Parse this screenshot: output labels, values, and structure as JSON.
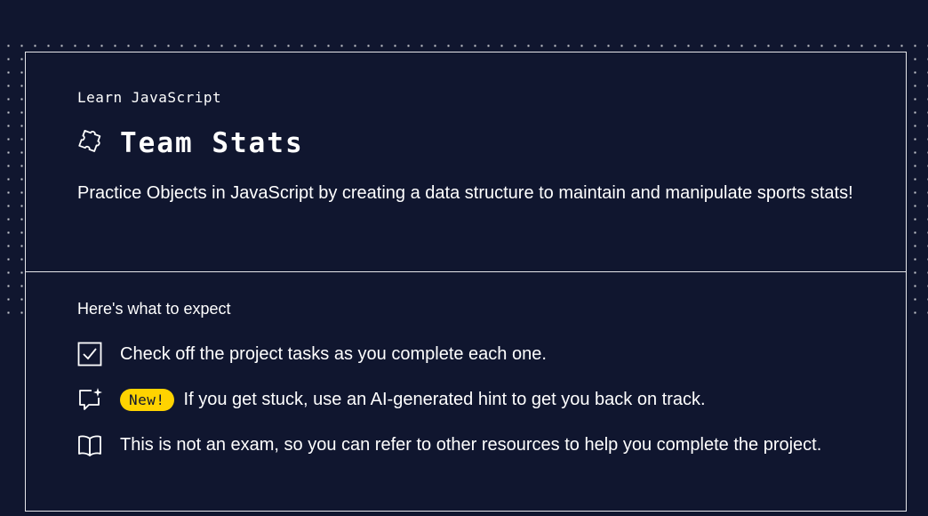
{
  "header": {
    "course": "Learn JavaScript",
    "title": "Team Stats",
    "description": "Practice Objects in JavaScript by creating a data structure to maintain and manipulate sports stats!"
  },
  "expect": {
    "title": "Here's what to expect",
    "items": [
      {
        "icon": "checkbox-icon",
        "text": "Check off the project tasks as you complete each one."
      },
      {
        "icon": "ai-hint-icon",
        "badge": "New!",
        "text": "If you get stuck, use an AI-generated hint to get you back on track."
      },
      {
        "icon": "book-icon",
        "text": "This is not an exam, so you can refer to other resources to help you complete the project."
      }
    ]
  },
  "colors": {
    "background": "#10162f",
    "badge": "#ffd300",
    "text": "#ffffff"
  }
}
